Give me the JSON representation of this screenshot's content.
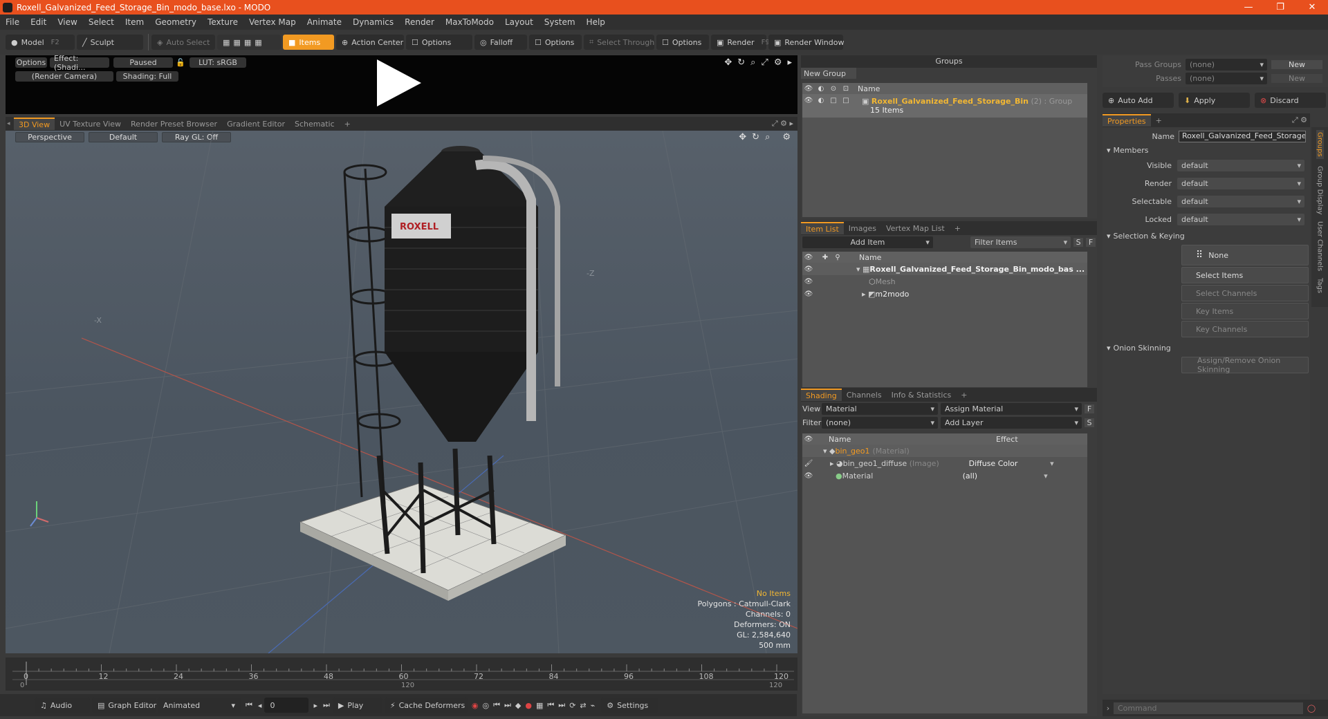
{
  "window": {
    "title": "Roxell_Galvanized_Feed_Storage_Bin_modo_base.lxo - MODO",
    "controls": [
      "—",
      "❐",
      "✕"
    ]
  },
  "menu": [
    "File",
    "Edit",
    "View",
    "Select",
    "Item",
    "Geometry",
    "Texture",
    "Vertex Map",
    "Animate",
    "Dynamics",
    "Render",
    "MaxToModo",
    "Layout",
    "System",
    "Help"
  ],
  "toolbar": {
    "model": "Model",
    "model_key": "F2",
    "sculpt": "Sculpt",
    "auto_select": "Auto Select",
    "items": "Items",
    "action_center": "Action Center",
    "options1": "Options",
    "falloff": "Falloff",
    "options2": "Options",
    "select_through": "Select Through",
    "options3": "Options",
    "render": "Render",
    "render_key": "F9",
    "render_window": "Render Window"
  },
  "preview": {
    "options": "Options",
    "effect": "Effect: (Shadi...",
    "paused": "Paused",
    "lut": "LUT: sRGB",
    "camera": "(Render Camera)",
    "shading": "Shading: Full"
  },
  "viewport_tabs": [
    "3D View",
    "UV Texture View",
    "Render Preset Browser",
    "Gradient Editor",
    "Schematic",
    "+"
  ],
  "viewport": {
    "view": "Perspective",
    "style": "Default",
    "raygl": "Ray GL: Off",
    "logo": "ROXELL",
    "axes": {
      "neg_x": "-X",
      "neg_z": "-Z"
    },
    "stats": {
      "no_items": "No Items",
      "polygons": "Polygons : Catmull-Clark",
      "channels": "Channels: 0",
      "deformers": "Deformers: ON",
      "gl": "GL: 2,584,640",
      "scale": "500 mm"
    }
  },
  "timeline": {
    "ticks": [
      "0",
      "12",
      "24",
      "36",
      "48",
      "60",
      "72",
      "84",
      "96",
      "108",
      "120"
    ],
    "lower": [
      "0",
      "120",
      "120"
    ]
  },
  "bottombar": {
    "audio": "Audio",
    "graph_editor": "Graph Editor",
    "animated": "Animated",
    "frame": "0",
    "play": "Play",
    "cache": "Cache Deformers",
    "settings": "Settings"
  },
  "groups": {
    "title": "Groups",
    "new_group": "New Group",
    "col_name": "Name",
    "item_name": "Roxell_Galvanized_Feed_Storage_Bin",
    "item_suffix": "(2) : Group",
    "item_count": "15 Items"
  },
  "itemlist": {
    "tabs": [
      "Item List",
      "Images",
      "Vertex Map List",
      "+"
    ],
    "add_item": "Add Item",
    "filter": "Filter Items",
    "s": "S",
    "f": "F",
    "col_name": "Name",
    "rows": [
      {
        "name": "Roxell_Galvanized_Feed_Storage_Bin_modo_bas ...",
        "indent": 0
      },
      {
        "name": "Mesh",
        "indent": 1
      },
      {
        "name": "m2modo",
        "indent": 1
      }
    ]
  },
  "shading": {
    "tabs": [
      "Shading",
      "Channels",
      "Info & Statistics",
      "+"
    ],
    "view_lbl": "View",
    "view_val": "Material",
    "assign": "Assign Material",
    "f": "F",
    "filter_lbl": "Filter",
    "filter_val": "(none)",
    "add_layer": "Add Layer",
    "s": "S",
    "col_name": "Name",
    "col_effect": "Effect",
    "rows": [
      {
        "name": "bin_geo1",
        "suffix": "(Material)",
        "effect": ""
      },
      {
        "name": "bin_geo1_diffuse",
        "suffix": "(Image)",
        "effect": "Diffuse Color"
      },
      {
        "name": "Material",
        "suffix": "",
        "effect": "(all)"
      }
    ]
  },
  "passgroups": {
    "pass_groups": "Pass Groups",
    "passes": "Passes",
    "none": "(none)",
    "new": "New"
  },
  "actions": {
    "auto_add": "Auto Add",
    "apply": "Apply",
    "discard": "Discard"
  },
  "properties": {
    "tab": "Properties",
    "plus": "+",
    "name_lbl": "Name",
    "name_val": "Roxell_Galvanized_Feed_Storage_B",
    "members": "Members",
    "fields": [
      {
        "label": "Visible",
        "value": "default"
      },
      {
        "label": "Render",
        "value": "default"
      },
      {
        "label": "Selectable",
        "value": "default"
      },
      {
        "label": "Locked",
        "value": "default"
      }
    ],
    "selection_keying": "Selection & Keying",
    "none": "None",
    "select_items": "Select Items",
    "select_channels": "Select Channels",
    "key_items": "Key Items",
    "key_channels": "Key Channels",
    "onion": "Onion Skinning",
    "onion_btn": "Assign/Remove Onion Skinning"
  },
  "side_tabs": [
    "Groups",
    "Group Display",
    "User Channels",
    "Tags"
  ],
  "command": {
    "placeholder": "Command"
  },
  "colors": {
    "accent": "#f29a22",
    "titlebar": "#e8501e",
    "group_item": "#f2b733"
  }
}
